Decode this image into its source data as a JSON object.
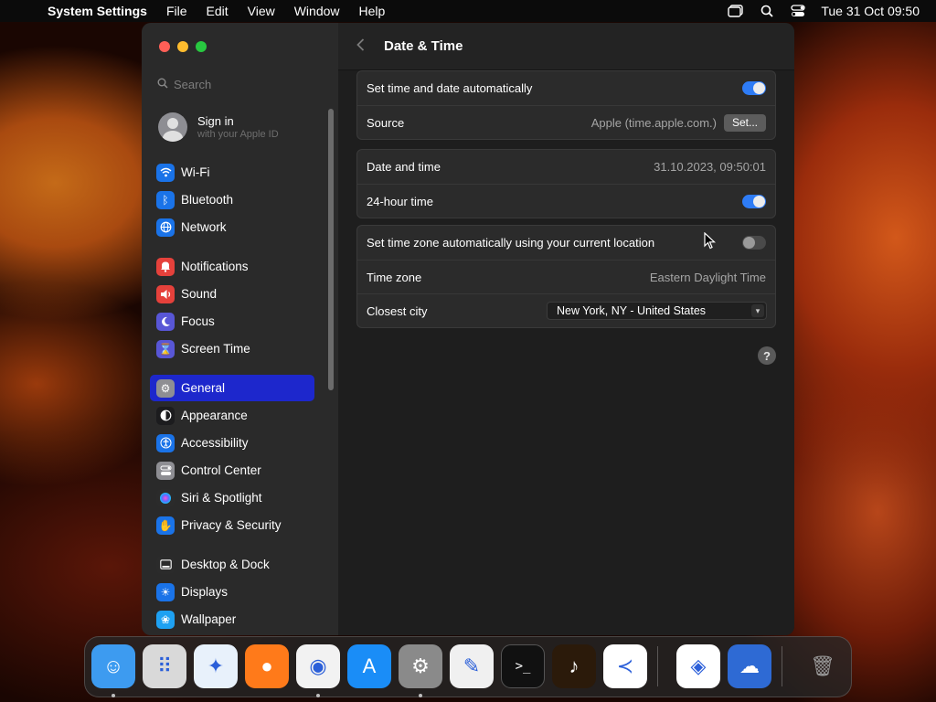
{
  "menubar": {
    "app_name": "System Settings",
    "items": [
      "File",
      "Edit",
      "View",
      "Window",
      "Help"
    ],
    "clock": "Tue 31 Oct  09:50"
  },
  "sidebar": {
    "search_placeholder": "Search",
    "signin_title": "Sign in",
    "signin_subtitle": "with your Apple ID",
    "items": [
      {
        "label": "Wi-Fi",
        "icon": "wifi-icon",
        "color": "#1a73e8"
      },
      {
        "label": "Bluetooth",
        "icon": "bluetooth-icon",
        "color": "#1a73e8"
      },
      {
        "label": "Network",
        "icon": "globe-icon",
        "color": "#1a73e8"
      },
      {
        "label": "Notifications",
        "icon": "bell-icon",
        "color": "#e5413b"
      },
      {
        "label": "Sound",
        "icon": "speaker-icon",
        "color": "#e5413b"
      },
      {
        "label": "Focus",
        "icon": "moon-icon",
        "color": "#5856d6"
      },
      {
        "label": "Screen Time",
        "icon": "hourglass-icon",
        "color": "#5856d6"
      },
      {
        "label": "General",
        "icon": "gear-icon",
        "color": "#8e8e93",
        "selected": true
      },
      {
        "label": "Appearance",
        "icon": "appearance-icon",
        "color": "#1c1c1e"
      },
      {
        "label": "Accessibility",
        "icon": "accessibility-icon",
        "color": "#1a73e8"
      },
      {
        "label": "Control Center",
        "icon": "control-center-icon",
        "color": "#8e8e93"
      },
      {
        "label": "Siri & Spotlight",
        "icon": "siri-icon",
        "color": "#2b2b2b"
      },
      {
        "label": "Privacy & Security",
        "icon": "hand-icon",
        "color": "#1a73e8"
      },
      {
        "label": "Desktop & Dock",
        "icon": "dock-icon",
        "color": "#2b2b2b"
      },
      {
        "label": "Displays",
        "icon": "sun-icon",
        "color": "#1a73e8"
      },
      {
        "label": "Wallpaper",
        "icon": "flower-icon",
        "color": "#1ea1f2"
      }
    ]
  },
  "header": {
    "title": "Date & Time"
  },
  "rows": {
    "auto_time_label": "Set time and date automatically",
    "source_label": "Source",
    "source_value": "Apple (time.apple.com.)",
    "set_button": "Set...",
    "date_time_label": "Date and time",
    "date_time_value": "31.10.2023, 09:50:01",
    "hour24_label": "24-hour time",
    "auto_tz_label": "Set time zone automatically using your current location",
    "timezone_label": "Time zone",
    "timezone_value": "Eastern Daylight Time",
    "closest_city_label": "Closest city",
    "closest_city_value": "New York, NY - United States"
  },
  "toggles": {
    "auto_time": true,
    "hour24": true,
    "auto_timezone": false
  },
  "help_label": "?",
  "dock": [
    {
      "name": "finder-icon",
      "color": "#3d9bf0",
      "glyph": "☺",
      "running": true
    },
    {
      "name": "launchpad-icon",
      "color": "#d9d9d9",
      "glyph": "⠿",
      "running": false
    },
    {
      "name": "safari-icon",
      "color": "#e8f1fb",
      "glyph": "✦",
      "running": false
    },
    {
      "name": "firefox-icon",
      "color": "#ff7a1a",
      "glyph": "●",
      "running": false
    },
    {
      "name": "chrome-icon",
      "color": "#f2f2f2",
      "glyph": "◉",
      "running": true
    },
    {
      "name": "app-store-icon",
      "color": "#1a8df7",
      "glyph": "A",
      "running": false
    },
    {
      "name": "system-settings-icon",
      "color": "#8a8a8a",
      "glyph": "⚙",
      "running": true
    },
    {
      "name": "textedit-icon",
      "color": "#f0f0f0",
      "glyph": "✎",
      "running": false
    },
    {
      "name": "terminal-icon",
      "color": "#111111",
      "glyph": ">_",
      "running": false
    },
    {
      "name": "garageband-icon",
      "color": "#2b1a0a",
      "glyph": "♪",
      "running": false
    },
    {
      "name": "vscode-icon",
      "color": "#ffffff",
      "glyph": "≺",
      "running": false
    },
    {
      "name": "visual-studio-icon",
      "color": "#ffffff",
      "glyph": "◈",
      "running": false
    },
    {
      "name": "weather-icon",
      "color": "#2e6ad4",
      "glyph": "☁",
      "running": false
    },
    {
      "name": "trash-icon",
      "color": "#6f6f6f",
      "glyph": "🗑",
      "running": false
    }
  ]
}
